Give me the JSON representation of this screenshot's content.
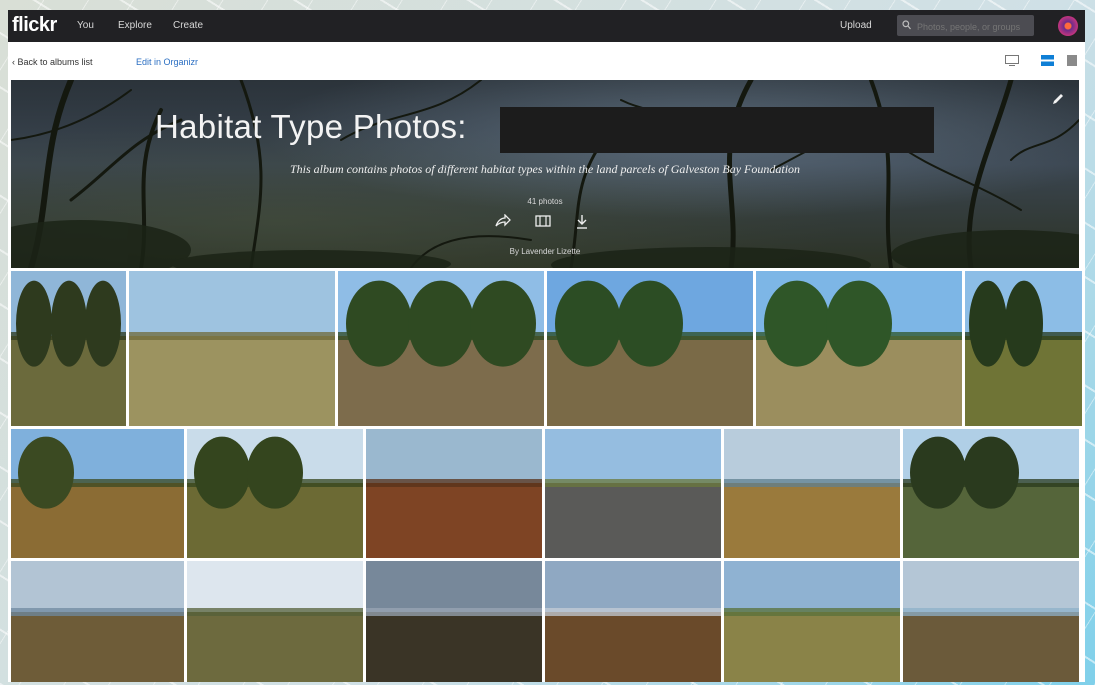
{
  "header": {
    "logo": "flickr",
    "nav": [
      "You",
      "Explore",
      "Create"
    ],
    "upload": "Upload",
    "search_placeholder": "Photos, people, or groups"
  },
  "subnav": {
    "back": "Back to albums list",
    "edit": "Edit in Organizr"
  },
  "album": {
    "title": "Habitat Type Photos:",
    "description": "This album contains photos of different habitat types within the land parcels of Galveston Bay Foundation",
    "count": "41 photos",
    "by": "By Lavender Lizette"
  },
  "colors": {
    "topbar": "#212124",
    "link": "#2a6ec2",
    "accent": "#0063dc"
  },
  "icons": [
    "search-icon",
    "share-icon",
    "slideshow-icon",
    "download-icon",
    "pencil-icon",
    "layout-icon",
    "grid-view-icon",
    "list-view-icon"
  ],
  "photos": [
    {
      "sky": "#8fb6d8",
      "ground": "#6b6a3c",
      "accent": "#2e3a1e",
      "trees": 3
    },
    {
      "sky": "#9ec3e0",
      "ground": "#9c9360",
      "accent": "#6f6a3a",
      "trees": 0
    },
    {
      "sky": "#8fbde6",
      "ground": "#7d6c4c",
      "accent": "#2f4a22",
      "trees": 3
    },
    {
      "sky": "#6ea7e0",
      "ground": "#7a6a47",
      "accent": "#2c4d24",
      "trees": 2
    },
    {
      "sky": "#7db6e6",
      "ground": "#9b8e5e",
      "accent": "#2f5628",
      "trees": 2
    },
    {
      "sky": "#8cbde6",
      "ground": "#6f7436",
      "accent": "#263a1c",
      "trees": 2
    },
    {
      "sky": "#7fb0dc",
      "ground": "#8b6c34",
      "accent": "#3b4a22",
      "trees": 1
    },
    {
      "sky": "#c9dcea",
      "ground": "#6c6a34",
      "accent": "#34451e",
      "trees": 2
    },
    {
      "sky": "#9ab8cf",
      "ground": "#7e4424",
      "accent": "#57321a",
      "trees": 0
    },
    {
      "sky": "#95bde0",
      "ground": "#5a5a58",
      "accent": "#6b7a3c",
      "trees": 0
    },
    {
      "sky": "#b8ccdc",
      "ground": "#9a7a3c",
      "accent": "#5f8090",
      "trees": 0
    },
    {
      "sky": "#b0cfe6",
      "ground": "#55653a",
      "accent": "#2a3a1e",
      "trees": 2
    },
    {
      "sky": "#b2c4d4",
      "ground": "#6e5c38",
      "accent": "#6f8aa0",
      "trees": 0
    },
    {
      "sky": "#dde6ee",
      "ground": "#6d6a3e",
      "accent": "#54603a",
      "trees": 0
    },
    {
      "sky": "#77889a",
      "ground": "#3a3426",
      "accent": "#9aa6b4",
      "trees": 0
    },
    {
      "sky": "#8fa8c2",
      "ground": "#6a4a2a",
      "accent": "#c4ccd6",
      "trees": 0
    },
    {
      "sky": "#8fb2d2",
      "ground": "#8a8348",
      "accent": "#58703a",
      "trees": 0
    },
    {
      "sky": "#b4c6d6",
      "ground": "#6b5a3a",
      "accent": "#8eb0c8",
      "trees": 0
    }
  ]
}
